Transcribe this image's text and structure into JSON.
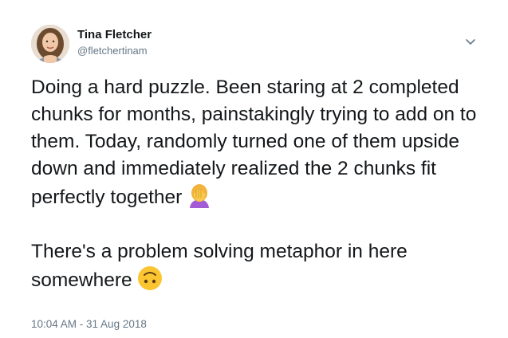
{
  "user": {
    "display_name": "Tina Fletcher",
    "handle": "@fletchertinam"
  },
  "tweet": {
    "paragraph_1": "Doing a hard puzzle. Been staring at 2 completed chunks for months, painstakingly trying to add on to them. Today, randomly turned one of them upside down and immediately realized the 2 chunks fit perfectly together",
    "paragraph_1_emoji": "woman-facepalming-icon",
    "paragraph_2": "There's a problem solving metaphor in here somewhere",
    "paragraph_2_emoji": "upside-down-face-icon",
    "timestamp": "10:04 AM - 31 Aug 2018"
  },
  "menu": {
    "icon": "chevron-down-icon"
  },
  "colors": {
    "text": "#14171a",
    "secondary": "#657786",
    "chevron": "#657786"
  }
}
